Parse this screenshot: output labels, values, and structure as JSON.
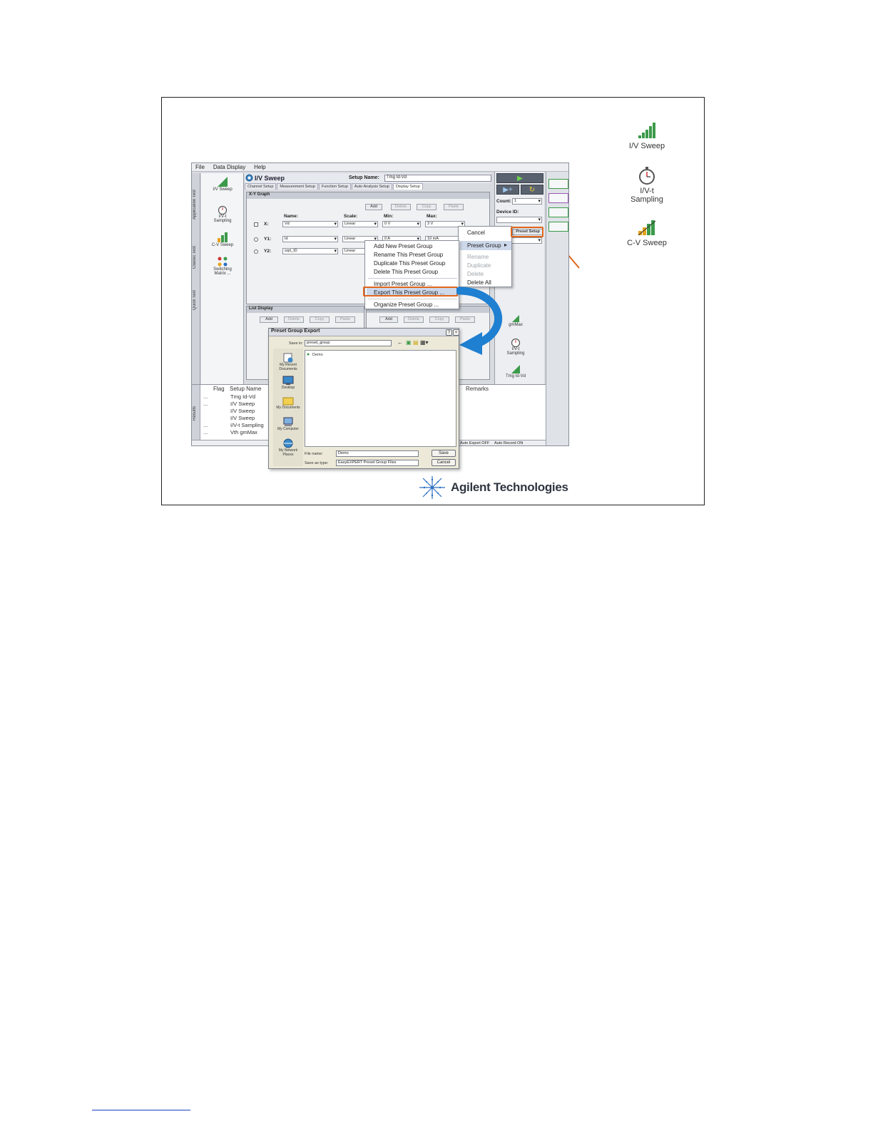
{
  "side_icons": [
    {
      "label": "I/V Sweep",
      "icon": "iv-sweep-icon"
    },
    {
      "label": "I/V-t\nSampling",
      "icon": "stopwatch-icon"
    },
    {
      "label": "C-V Sweep",
      "icon": "cv-sweep-icon"
    }
  ],
  "menu_bar": [
    "File",
    "Data Display",
    "Help"
  ],
  "vertical_tabs": [
    "Application Test",
    "Classic Test",
    "Quick Test"
  ],
  "library": [
    {
      "label": "I/V Sweep"
    },
    {
      "label": "I/V-t\nSampling"
    },
    {
      "label": "C-V Sweep"
    },
    {
      "label": "Switching\nMatrix ..."
    }
  ],
  "header": {
    "title": "I/V Sweep",
    "setup_name_label": "Setup Name:",
    "setup_name_value": "Tmg Id-Vd"
  },
  "tabs": [
    "Channel Setup",
    "Measurement Setup",
    "Function Setup",
    "Auto Analysis Setup",
    "Display Setup"
  ],
  "xy_graph": {
    "title": "X-Y Graph",
    "buttons": [
      "Add",
      "Delete",
      "Copy",
      "Paste"
    ],
    "headers": {
      "name": "Name:",
      "scale": "Scale:",
      "min": "Min:",
      "max": "Max:"
    },
    "rows": [
      {
        "axis": "X:",
        "name": "Vd",
        "scale": "Linear",
        "min": "0 V",
        "max": "3 V"
      },
      {
        "axis": "Y1:",
        "name": "Id",
        "scale": "Linear",
        "min": "0 A",
        "max": "10 mA"
      },
      {
        "axis": "Y2:",
        "name": "sqrt_ID",
        "scale": "Linear",
        "min": "",
        "max": ""
      }
    ]
  },
  "list_display": {
    "title": "List Display",
    "buttons": [
      "Add",
      "Delete",
      "Copy",
      "Paste"
    ]
  },
  "parameters": {
    "title": "Parameters",
    "buttons": [
      "Add",
      "Delete",
      "Copy",
      "Paste"
    ]
  },
  "right_panel": {
    "count_label": "Count:",
    "count_value": "1",
    "device_id_label": "Device ID:",
    "preset_button": "Preset Setup",
    "library_labels": [
      "gmMax",
      "I/V-t\nSampling",
      "Tmg Id-Vd"
    ]
  },
  "preset_menu": {
    "items": [
      "Cancel",
      "Preset Group",
      "Rename",
      "Duplicate",
      "Delete",
      "Delete All"
    ]
  },
  "group_menu": {
    "items": [
      "Add New Preset Group",
      "Rename This Preset Group",
      "Duplicate This Preset Group",
      "Delete This Preset Group",
      "Import Preset Group ...",
      "Export This Preset Group ...",
      "Organize Preset Group ..."
    ]
  },
  "results": {
    "tab_label": "Results",
    "columns": {
      "flag": "Flag",
      "setup": "Setup Name",
      "remarks": "Remarks"
    },
    "rows": [
      {
        "flag": "...",
        "setup": "Tmg Id-Vd"
      },
      {
        "flag": "...",
        "setup": "I/V Sweep"
      },
      {
        "flag": "",
        "setup": "I/V Sweep"
      },
      {
        "flag": "",
        "setup": "I/V Sweep"
      },
      {
        "flag": "...",
        "setup": "I/V-t Sampling"
      },
      {
        "flag": "...",
        "setup": "Vth gmMax"
      }
    ]
  },
  "status": {
    "export": "Auto Export OFF",
    "record": "Auto Record ON"
  },
  "export_dialog": {
    "title": "Preset Group Export",
    "save_in_label": "Save in:",
    "save_in_value": "preset_group",
    "file_item": "Demo",
    "places": [
      "My Recent\nDocuments",
      "Desktop",
      "My Documents",
      "My Computer",
      "My Network\nPlaces"
    ],
    "file_name_label": "File name:",
    "file_name_value": "Demo",
    "save_type_label": "Save as type:",
    "save_type_value": "EasyEXPERT Preset Group Files",
    "save_button": "Save",
    "cancel_button": "Cancel"
  },
  "logo": {
    "text": "Agilent Technologies"
  },
  "colors": {
    "highlight": "#e0651a",
    "arrow_blue": "#1f7fd1",
    "run_green": "#6fd34f"
  }
}
